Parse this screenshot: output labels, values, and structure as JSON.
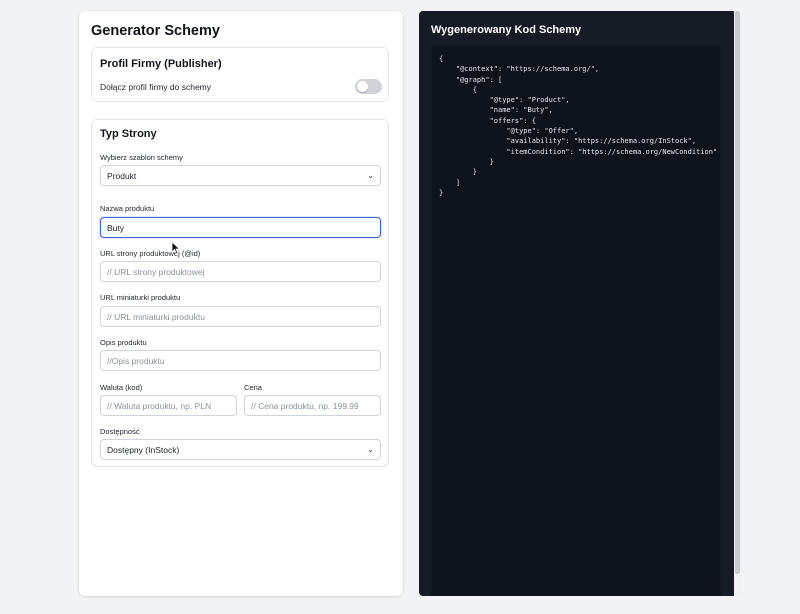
{
  "left": {
    "title": "Generator Schemy",
    "publisher": {
      "title": "Profil Firmy (Publisher)",
      "toggle_label": "Dołącz profil firmy do schemy",
      "toggle_on": false
    },
    "page_type": {
      "title": "Typ Strony",
      "template_label": "Wybierz szablon schemy",
      "template_value": "Produkt",
      "name_label": "Nazwa produktu",
      "name_value": "Buty",
      "url_label": "URL strony produktowej (@id)",
      "url_placeholder": "// URL strony produktowej",
      "thumb_label": "URL miniaturki produktu",
      "thumb_placeholder": "// URL miniaturki produktu",
      "desc_label": "Opis produktu",
      "desc_placeholder": "//Opis produktu",
      "currency_label": "Waluta (kod)",
      "currency_placeholder": "// Waluta produktu, np. PLN",
      "price_label": "Cena",
      "price_placeholder": "// Cena produktu, np. 199.99",
      "availability_label": "Dostępność",
      "availability_value": "Dostępny (InStock)"
    }
  },
  "right": {
    "title": "Wygenerowany Kod Schemy",
    "code": "{\n    \"@context\": \"https://schema.org/\",\n    \"@graph\": [\n        {\n            \"@type\": \"Product\",\n            \"name\": \"Buty\",\n            \"offers\": {\n                \"@type\": \"Offer\",\n                \"availability\": \"https://schema.org/InStock\",\n                \"itemCondition\": \"https://schema.org/NewCondition\"\n            }\n        }\n    ]\n}"
  },
  "icons": {
    "select_chevron": "chevron-down-icon",
    "mouse_cursor": "cursor-icon"
  }
}
